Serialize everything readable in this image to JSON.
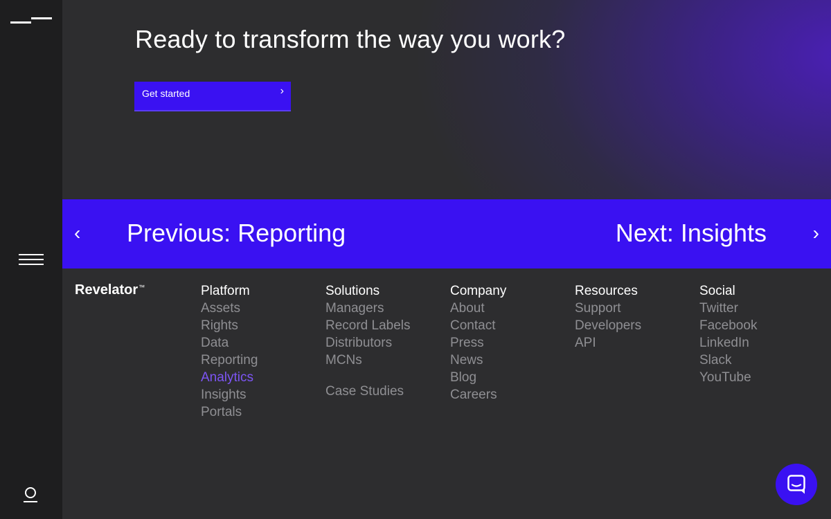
{
  "hero": {
    "title": "Ready to transform the way you work?",
    "cta_label": "Get started",
    "cta_arrow": "›"
  },
  "pager": {
    "prev_arrow": "‹",
    "prev_label": "Previous: Reporting",
    "next_label": "Next: Insights",
    "next_arrow": "›"
  },
  "footer": {
    "brand": "Revelator",
    "brand_mark": "™",
    "columns": [
      {
        "title": "Platform",
        "links": [
          "Assets",
          "Rights",
          "Data",
          "Reporting",
          "Analytics",
          "Insights",
          "Portals"
        ],
        "active": "Analytics"
      },
      {
        "title": "Solutions",
        "links": [
          "Managers",
          "Record Labels",
          "Distributors",
          "MCNs",
          "Case Studies"
        ]
      },
      {
        "title": "Company",
        "links": [
          "About",
          "Contact",
          "Press",
          "News",
          "Blog",
          "Careers"
        ]
      },
      {
        "title": "Resources",
        "links": [
          "Support",
          "Developers",
          "API"
        ]
      },
      {
        "title": "Social",
        "links": [
          "Twitter",
          "Facebook",
          "LinkedIn",
          "Slack",
          "YouTube"
        ]
      }
    ]
  },
  "icons": {
    "logo": "logo-mark-icon",
    "menu": "hamburger-menu-icon",
    "user": "user-icon",
    "chat": "chat-icon"
  },
  "colors": {
    "accent": "#3a11f2",
    "active_link": "#7d55f5",
    "muted_link": "#8f8f93",
    "background": "#2d2d2f",
    "rail": "#1e1e1f"
  }
}
